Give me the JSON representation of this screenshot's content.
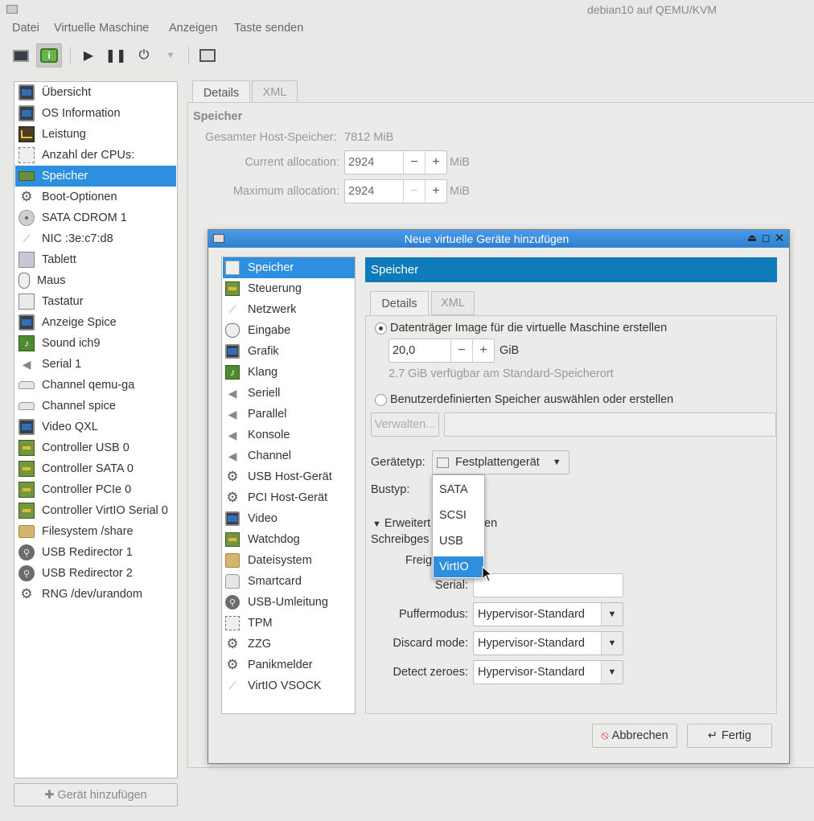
{
  "window": {
    "title": "debian10 auf QEMU/KVM"
  },
  "menubar": [
    "Datei",
    "Virtuelle Maschine",
    "Anzeigen",
    "Taste senden"
  ],
  "sidebar": {
    "items": [
      {
        "label": "Übersicht",
        "icon": "monitor-icon"
      },
      {
        "label": "OS Information",
        "icon": "monitor-icon"
      },
      {
        "label": "Leistung",
        "icon": "chart-icon"
      },
      {
        "label": "Anzahl der CPUs:",
        "icon": "cpu-icon"
      },
      {
        "label": "Speicher",
        "icon": "memory-icon",
        "selected": true
      },
      {
        "label": "Boot-Optionen",
        "icon": "gear-icon"
      },
      {
        "label": "SATA CDROM 1",
        "icon": "disc-icon"
      },
      {
        "label": "NIC :3e:c7:d8",
        "icon": "network-icon"
      },
      {
        "label": "Tablett",
        "icon": "tablet-icon"
      },
      {
        "label": "Maus",
        "icon": "mouse-icon"
      },
      {
        "label": "Tastatur",
        "icon": "keyboard-icon"
      },
      {
        "label": "Anzeige Spice",
        "icon": "monitor-icon"
      },
      {
        "label": "Sound ich9",
        "icon": "sound-icon"
      },
      {
        "label": "Serial 1",
        "icon": "serial-icon"
      },
      {
        "label": "Channel qemu-ga",
        "icon": "channel-icon"
      },
      {
        "label": "Channel spice",
        "icon": "channel-icon"
      },
      {
        "label": "Video QXL",
        "icon": "monitor-icon"
      },
      {
        "label": "Controller USB 0",
        "icon": "pci-icon"
      },
      {
        "label": "Controller SATA 0",
        "icon": "pci-icon"
      },
      {
        "label": "Controller PCIe 0",
        "icon": "pci-icon"
      },
      {
        "label": "Controller VirtIO Serial 0",
        "icon": "pci-icon"
      },
      {
        "label": "Filesystem /share",
        "icon": "folder-icon"
      },
      {
        "label": "USB Redirector 1",
        "icon": "usb-icon"
      },
      {
        "label": "USB Redirector 2",
        "icon": "usb-icon"
      },
      {
        "label": "RNG /dev/urandom",
        "icon": "gear-icon"
      }
    ],
    "add_button": "Gerät hinzufügen"
  },
  "details": {
    "tabs": [
      "Details",
      "XML"
    ],
    "section_title": "Speicher",
    "host_memory_label": "Gesamter Host-Speicher:",
    "host_memory_value": "7812 MiB",
    "current_label": "Current allocation:",
    "current_value": "2924",
    "max_label": "Maximum allocation:",
    "max_value": "2924",
    "unit": "MiB"
  },
  "dialog": {
    "title": "Neue virtuelle Geräte hinzufügen",
    "list": [
      {
        "label": "Speicher",
        "icon": "storage-icon",
        "selected": true
      },
      {
        "label": "Steuerung",
        "icon": "pci-icon"
      },
      {
        "label": "Netzwerk",
        "icon": "network-icon"
      },
      {
        "label": "Eingabe",
        "icon": "mouse-icon"
      },
      {
        "label": "Grafik",
        "icon": "monitor-icon"
      },
      {
        "label": "Klang",
        "icon": "sound-icon"
      },
      {
        "label": "Seriell",
        "icon": "serial-icon"
      },
      {
        "label": "Parallel",
        "icon": "serial-icon"
      },
      {
        "label": "Konsole",
        "icon": "serial-icon"
      },
      {
        "label": "Channel",
        "icon": "serial-icon"
      },
      {
        "label": "USB Host-Gerät",
        "icon": "gear-icon"
      },
      {
        "label": "PCI Host-Gerät",
        "icon": "gear-icon"
      },
      {
        "label": "Video",
        "icon": "monitor-icon"
      },
      {
        "label": "Watchdog",
        "icon": "pci-icon"
      },
      {
        "label": "Dateisystem",
        "icon": "folder-icon"
      },
      {
        "label": "Smartcard",
        "icon": "channel-icon"
      },
      {
        "label": "USB-Umleitung",
        "icon": "usb-icon"
      },
      {
        "label": "TPM",
        "icon": "cpu-icon"
      },
      {
        "label": "ZZG",
        "icon": "gear-icon"
      },
      {
        "label": "Panikmelder",
        "icon": "gear-icon"
      },
      {
        "label": "VirtIO VSOCK",
        "icon": "network-icon"
      }
    ],
    "header": "Speicher",
    "tabs": [
      "Details",
      "XML"
    ],
    "radio_create": "Datenträger Image für die virtuelle Maschine erstellen",
    "size_value": "20,0",
    "size_unit": "GiB",
    "available": "2.7 GiB verfügbar am Standard-Speicherort",
    "radio_custom": "Benutzerdefinierten Speicher auswählen oder erstellen",
    "manage_button": "Verwalten...",
    "device_type_label": "Gerätetyp:",
    "device_type_value": "Festplattengerät",
    "bus_type_label": "Bustyp:",
    "bus_options": [
      "SATA",
      "SCSI",
      "USB",
      "VirtIO"
    ],
    "bus_selected": "VirtIO",
    "advanced_label": "Erweitert",
    "advanced_tail": "en",
    "readonly_label": "Schreibges",
    "shareable_label": "Freig",
    "serial_label": "Serial:",
    "cache_label": "Puffermodus:",
    "cache_value": "Hypervisor-Standard",
    "discard_label": "Discard mode:",
    "discard_value": "Hypervisor-Standard",
    "zeroes_label": "Detect zeroes:",
    "zeroes_value": "Hypervisor-Standard",
    "cancel_button": "Abbrechen",
    "finish_button": "Fertig"
  }
}
